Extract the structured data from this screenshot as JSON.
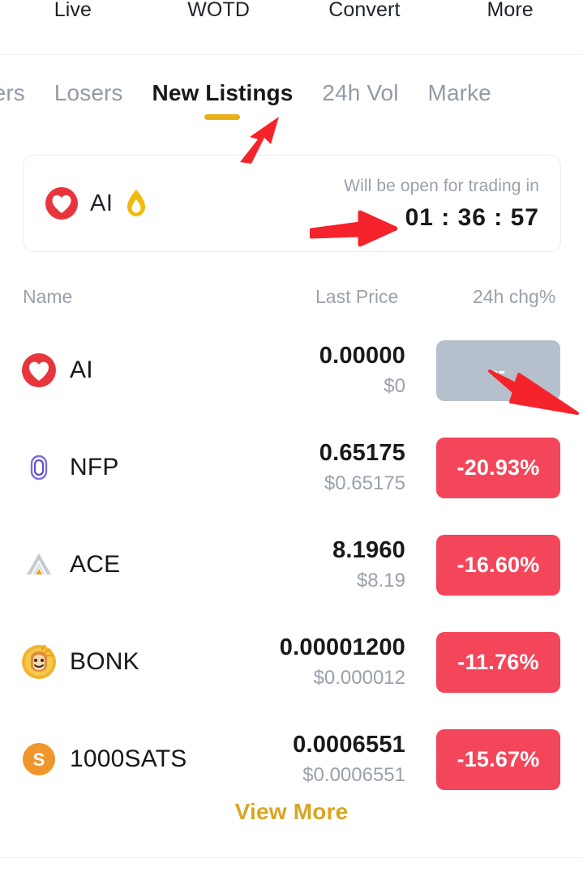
{
  "topnav": {
    "items": [
      {
        "label": "Live"
      },
      {
        "label": "WOTD"
      },
      {
        "label": "Convert"
      },
      {
        "label": "More"
      }
    ]
  },
  "tabs": {
    "items": [
      {
        "label": "ainers",
        "active": false
      },
      {
        "label": "Losers",
        "active": false
      },
      {
        "label": "New Listings",
        "active": true
      },
      {
        "label": "24h Vol",
        "active": false
      },
      {
        "label": "Marke",
        "active": false
      }
    ],
    "active_indicator_color": "#e8b019"
  },
  "banner": {
    "icon": "ai-heart-icon",
    "symbol": "AI",
    "flame_icon": "flame-icon",
    "note": "Will be open for trading in",
    "timer": "01 : 36 : 57"
  },
  "table": {
    "headers": {
      "name": "Name",
      "last_price": "Last Price",
      "change": "24h chg%"
    },
    "rows": [
      {
        "icon": "ai-heart-icon",
        "symbol": "AI",
        "price": "0.00000",
        "usd": "$0",
        "change": "--",
        "change_state": "neutral"
      },
      {
        "icon": "nfp-icon",
        "symbol": "NFP",
        "price": "0.65175",
        "usd": "$0.65175",
        "change": "-20.93%",
        "change_state": "down"
      },
      {
        "icon": "ace-icon",
        "symbol": "ACE",
        "price": "8.1960",
        "usd": "$8.19",
        "change": "-16.60%",
        "change_state": "down"
      },
      {
        "icon": "bonk-icon",
        "symbol": "BONK",
        "price": "0.00001200",
        "usd": "$0.000012",
        "change": "-11.76%",
        "change_state": "down"
      },
      {
        "icon": "sats-icon",
        "symbol": "1000SATS",
        "price": "0.0006551",
        "usd": "$0.0006551",
        "change": "-15.67%",
        "change_state": "down"
      }
    ]
  },
  "footer": {
    "view_more": "View More"
  },
  "colors": {
    "down_badge": "#f4465b",
    "neutral_badge": "#b6c0cc",
    "accent_gold": "#d9a521",
    "tab_indicator": "#e8b019",
    "annotation_arrow": "#f5232b"
  }
}
